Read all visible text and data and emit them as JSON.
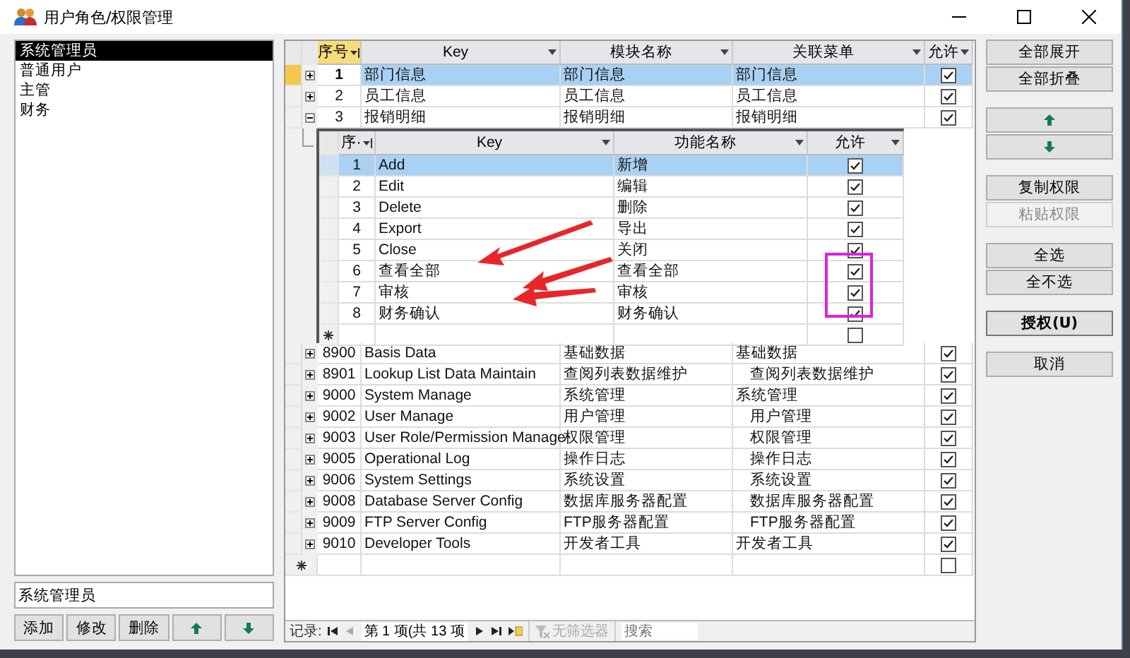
{
  "window": {
    "title": "用户角色/权限管理"
  },
  "roles": {
    "items": [
      {
        "label": "系统管理员",
        "selected": true
      },
      {
        "label": "普通用户",
        "selected": false
      },
      {
        "label": "主管",
        "selected": false
      },
      {
        "label": "财务",
        "selected": false
      }
    ]
  },
  "role_name_field": {
    "value": "系统管理员"
  },
  "role_buttons": [
    {
      "kind": "text",
      "label": "添加"
    },
    {
      "kind": "text",
      "label": "修改"
    },
    {
      "kind": "text",
      "label": "删除"
    },
    {
      "kind": "up"
    },
    {
      "kind": "down"
    }
  ],
  "grid": {
    "columns": [
      "序号",
      "Key",
      "模块名称",
      "关联菜单",
      "允许"
    ],
    "rows": [
      {
        "seq": "1",
        "key": "部门信息",
        "module": "部门信息",
        "menu": "部门信息",
        "submenu": false,
        "allowed": true,
        "selected": true,
        "expanded": false
      },
      {
        "seq": "2",
        "key": "员工信息",
        "module": "员工信息",
        "menu": "员工信息",
        "submenu": false,
        "allowed": true,
        "selected": false,
        "expanded": false
      },
      {
        "seq": "3",
        "key": "报销明细",
        "module": "报销明细",
        "menu": "报销明细",
        "submenu": false,
        "allowed": true,
        "selected": false,
        "expanded": true,
        "detail": {
          "columns": [
            "序·",
            "Key",
            "功能名称",
            "允许"
          ],
          "rows": [
            {
              "seq": "1",
              "key": "Add",
              "name": "新增",
              "allowed": true,
              "selected": true
            },
            {
              "seq": "2",
              "key": "Edit",
              "name": "编辑",
              "allowed": true,
              "selected": false
            },
            {
              "seq": "3",
              "key": "Delete",
              "name": "删除",
              "allowed": true,
              "selected": false
            },
            {
              "seq": "4",
              "key": "Export",
              "name": "导出",
              "allowed": true,
              "selected": false
            },
            {
              "seq": "5",
              "key": "Close",
              "name": "关闭",
              "allowed": true,
              "selected": false
            },
            {
              "seq": "6",
              "key": "查看全部",
              "name": "查看全部",
              "allowed": true,
              "selected": false
            },
            {
              "seq": "7",
              "key": "审核",
              "name": "审核",
              "allowed": true,
              "selected": false
            },
            {
              "seq": "8",
              "key": "财务确认",
              "name": "财务确认",
              "allowed": true,
              "selected": false
            }
          ],
          "new_row": {
            "allowed": false
          }
        }
      },
      {
        "seq": "8900",
        "key": "Basis Data",
        "module": "基础数据",
        "menu": "基础数据",
        "submenu": false,
        "allowed": true,
        "selected": false,
        "expanded": false
      },
      {
        "seq": "8901",
        "key": "Lookup List Data Maintain",
        "module": "查阅列表数据维护",
        "menu": "查阅列表数据维护",
        "submenu": true,
        "allowed": true,
        "selected": false,
        "expanded": false
      },
      {
        "seq": "9000",
        "key": "System Manage",
        "module": "系统管理",
        "menu": "系统管理",
        "submenu": false,
        "allowed": true,
        "selected": false,
        "expanded": false
      },
      {
        "seq": "9002",
        "key": "User Manage",
        "module": "用户管理",
        "menu": "用户管理",
        "submenu": true,
        "allowed": true,
        "selected": false,
        "expanded": false
      },
      {
        "seq": "9003",
        "key": "User Role/Permission Manage",
        "module": "权限管理",
        "menu": "权限管理",
        "submenu": true,
        "allowed": true,
        "selected": false,
        "expanded": false
      },
      {
        "seq": "9005",
        "key": "Operational Log",
        "module": "操作日志",
        "menu": "操作日志",
        "submenu": true,
        "allowed": true,
        "selected": false,
        "expanded": false
      },
      {
        "seq": "9006",
        "key": "System Settings",
        "module": "系统设置",
        "menu": "系统设置",
        "submenu": true,
        "allowed": true,
        "selected": false,
        "expanded": false
      },
      {
        "seq": "9008",
        "key": "Database Server Config",
        "module": "数据库服务器配置",
        "menu": "数据库服务器配置",
        "submenu": true,
        "allowed": true,
        "selected": false,
        "expanded": false
      },
      {
        "seq": "9009",
        "key": "FTP Server Config",
        "module": "FTP服务器配置",
        "menu": "FTP服务器配置",
        "submenu": true,
        "allowed": true,
        "selected": false,
        "expanded": false
      },
      {
        "seq": "9010",
        "key": "Developer Tools",
        "module": "开发者工具",
        "menu": "开发者工具",
        "submenu": false,
        "allowed": true,
        "selected": false,
        "expanded": false
      }
    ],
    "new_row": {
      "allowed": false
    }
  },
  "navigator": {
    "label": "记录:",
    "position": "第 1 项(共 13 项",
    "filter": "无筛选器",
    "search_placeholder": "搜索"
  },
  "side_buttons": [
    {
      "buttons": [
        {
          "kind": "text",
          "label": "全部展开",
          "disabled": false,
          "default": false
        },
        {
          "kind": "text",
          "label": "全部折叠",
          "disabled": false,
          "default": false
        }
      ]
    },
    {
      "buttons": [
        {
          "kind": "up",
          "disabled": false,
          "default": false
        },
        {
          "kind": "down",
          "disabled": false,
          "default": false
        }
      ]
    },
    {
      "buttons": [
        {
          "kind": "text",
          "label": "复制权限",
          "disabled": false,
          "default": false
        },
        {
          "kind": "text",
          "label": "粘贴权限",
          "disabled": true,
          "default": false
        }
      ]
    },
    {
      "buttons": [
        {
          "kind": "text",
          "label": "全选",
          "disabled": false,
          "default": false
        },
        {
          "kind": "text",
          "label": "全不选",
          "disabled": false,
          "default": false
        }
      ]
    },
    {
      "buttons": [
        {
          "kind": "text",
          "label": "授权(U)",
          "disabled": false,
          "default": true
        }
      ]
    },
    {
      "buttons": [
        {
          "kind": "text",
          "label": "取消",
          "disabled": false,
          "default": false
        }
      ]
    }
  ]
}
